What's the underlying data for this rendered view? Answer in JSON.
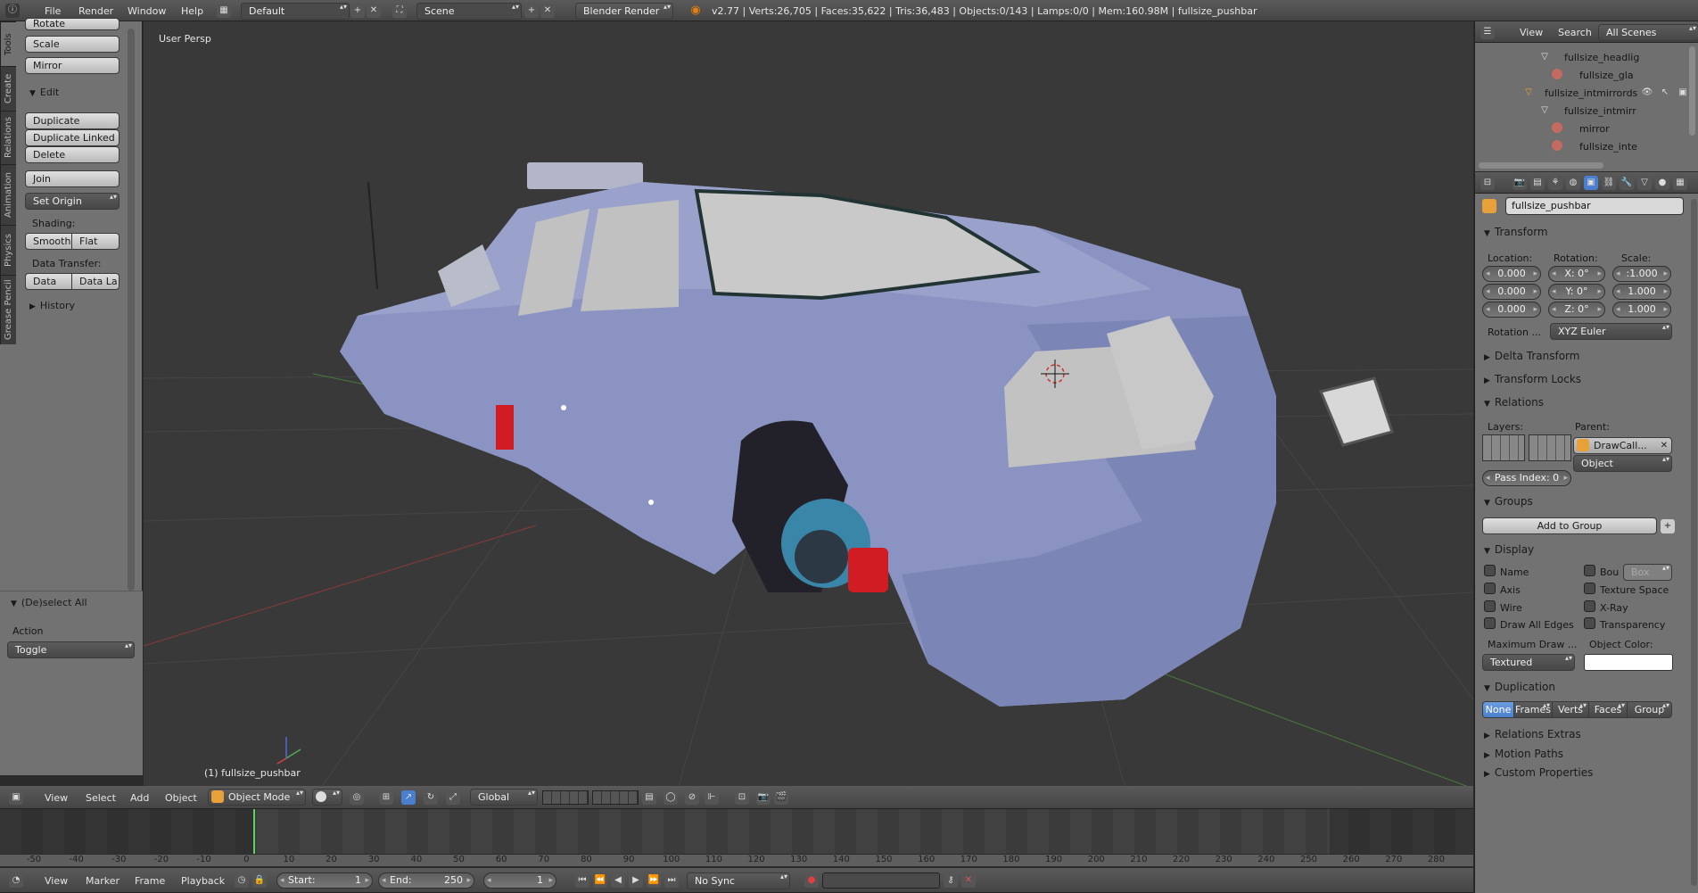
{
  "topbar": {
    "menus": [
      "File",
      "Render",
      "Window",
      "Help"
    ],
    "screen_layout": "Default",
    "scene": "Scene",
    "engine": "Blender Render",
    "stats": "v2.77 | Verts:26,705 | Faces:35,622 | Tris:36,483 | Objects:0/143 | Lamps:0/0 | Mem:160.98M | fullsize_pushbar"
  },
  "toolshelf": {
    "tabs": [
      "Tools",
      "Create",
      "Relations",
      "Animation",
      "Physics",
      "Grease Pencil"
    ],
    "rotate": "Rotate",
    "scale": "Scale",
    "mirror": "Mirror",
    "edit_header": "Edit",
    "duplicate": "Duplicate",
    "duplicate_linked": "Duplicate Linked",
    "delete": "Delete",
    "join": "Join",
    "set_origin": "Set Origin",
    "shading_label": "Shading:",
    "smooth": "Smooth",
    "flat": "Flat",
    "data_transfer_label": "Data Transfer:",
    "data": "Data",
    "data_layout": "Data La",
    "history_header": "History"
  },
  "operator": {
    "header": "(De)select All",
    "action_label": "Action",
    "action_value": "Toggle"
  },
  "viewport": {
    "view_name": "User Persp",
    "object_label": "(1) fullsize_pushbar",
    "menus": [
      "View",
      "Select",
      "Add",
      "Object"
    ],
    "mode": "Object Mode",
    "orientation": "Global"
  },
  "timeline": {
    "ruler": [
      "-50",
      "-40",
      "-30",
      "-20",
      "-10",
      "0",
      "10",
      "20",
      "30",
      "40",
      "50",
      "60",
      "70",
      "80",
      "90",
      "100",
      "110",
      "120",
      "130",
      "140",
      "150",
      "160",
      "170",
      "180",
      "190",
      "200",
      "210",
      "220",
      "230",
      "240",
      "250",
      "260",
      "270",
      "280"
    ],
    "current_frame_marker": 1,
    "menus": [
      "View",
      "Marker",
      "Frame",
      "Playback"
    ],
    "start_label": "Start:",
    "start_value": "1",
    "end_label": "End:",
    "end_value": "250",
    "current_frame": "1",
    "sync": "No Sync"
  },
  "outliner": {
    "menus": [
      "View",
      "Search"
    ],
    "filter": "All Scenes",
    "rows": [
      {
        "name": "fullsize_headlig"
      },
      {
        "name": "fullsize_gla"
      },
      {
        "name": "fullsize_intmirrords"
      },
      {
        "name": "fullsize_intmirr"
      },
      {
        "name": "mirror"
      },
      {
        "name": "fullsize_inte"
      }
    ]
  },
  "properties": {
    "object_name": "fullsize_pushbar",
    "transform": {
      "header": "Transform",
      "location_label": "Location:",
      "rotation_label": "Rotation:",
      "scale_label": "Scale:",
      "location": [
        "0.000",
        "0.000",
        "0.000"
      ],
      "rotation": [
        "X:   0°",
        "Y:   0°",
        "Z:   0°"
      ],
      "scale": [
        ":1.000",
        "1.000",
        "1.000"
      ],
      "rotation_mode_label": "Rotation ...",
      "rotation_mode": "XYZ Euler"
    },
    "delta_transform": "Delta Transform",
    "transform_locks": "Transform Locks",
    "relations": {
      "header": "Relations",
      "layers_label": "Layers:",
      "parent_label": "Parent:",
      "parent": "DrawCall...",
      "parent_type": "Object",
      "pass_index": "Pass Index:   0"
    },
    "groups": {
      "header": "Groups",
      "add": "Add to Group"
    },
    "display": {
      "header": "Display",
      "name": "Name",
      "bounds": "Bou",
      "bounds_type": "Box",
      "axis": "Axis",
      "texture_space": "Texture Space",
      "wire": "Wire",
      "xray": "X-Ray",
      "draw_all_edges": "Draw All Edges",
      "transparency": "Transparency",
      "max_draw_label": "Maximum Draw ...",
      "max_draw": "Textured",
      "object_color_label": "Object Color:"
    },
    "duplication": {
      "header": "Duplication",
      "options": [
        "None",
        "Frames",
        "Verts",
        "Faces",
        "Group"
      ],
      "selected": "None"
    },
    "relations_extras": "Relations Extras",
    "motion_paths": "Motion Paths",
    "custom_properties": "Custom Properties"
  },
  "colors": {
    "accent": "#5680c2",
    "viewport_bg": "#393939",
    "panel_bg": "#727272",
    "car_body": "#8a93c2"
  }
}
